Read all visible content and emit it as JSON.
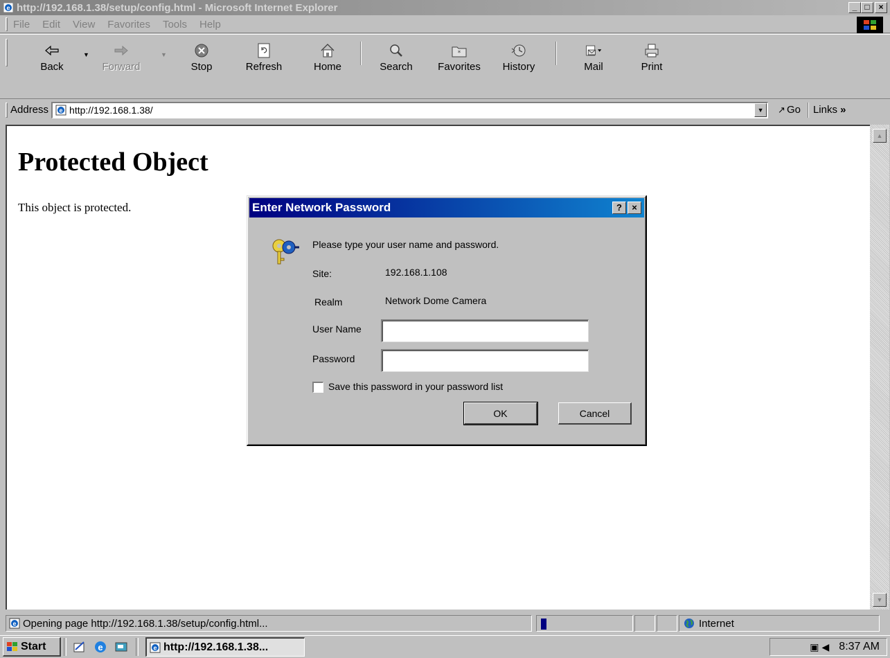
{
  "window": {
    "title": "http://192.168.1.38/setup/config.html - Microsoft Internet Explorer",
    "controls": {
      "minimize": "_",
      "maximize": "□",
      "close": "×"
    }
  },
  "menu": {
    "items": [
      {
        "label": "File",
        "key": "F"
      },
      {
        "label": "Edit",
        "key": "E"
      },
      {
        "label": "View",
        "key": "V"
      },
      {
        "label": "Favorites",
        "key": "a"
      },
      {
        "label": "Tools",
        "key": "T"
      },
      {
        "label": "Help",
        "key": "H"
      }
    ]
  },
  "toolbar": {
    "back": "Back",
    "forward": "Forward",
    "stop": "Stop",
    "refresh": "Refresh",
    "home": "Home",
    "search": "Search",
    "favorites": "Favorites",
    "history": "History",
    "mail": "Mail",
    "print": "Print"
  },
  "address": {
    "label": "Address",
    "url": "http://192.168.1.38/",
    "go": "Go",
    "links": "Links"
  },
  "page": {
    "heading": "Protected Object",
    "body": "This object is protected."
  },
  "dialog": {
    "title": "Enter Network Password",
    "help_btn": "?",
    "close_btn": "×",
    "prompt": "Please type your user name and password.",
    "site_label": "Site:",
    "site_value": "192.168.1.108",
    "realm_label": "Realm",
    "realm_value": "Network Dome Camera",
    "username_label": "User Name",
    "username_value": "",
    "password_label": "Password",
    "password_value": "",
    "save_label": "Save this password in your password list",
    "save_checked": false,
    "ok_label": "OK",
    "cancel_label": "Cancel"
  },
  "statusbar": {
    "message": "Opening page http://192.168.1.38/setup/config.html...",
    "progress": 0.05,
    "zone": "Internet"
  },
  "taskbar": {
    "start": "Start",
    "task": "http://192.168.1.38...",
    "clock": "8:37 AM"
  },
  "colors": {
    "dialog_title_start": "#000080",
    "dialog_title_end": "#1084d0",
    "face": "#c0c0c0"
  }
}
